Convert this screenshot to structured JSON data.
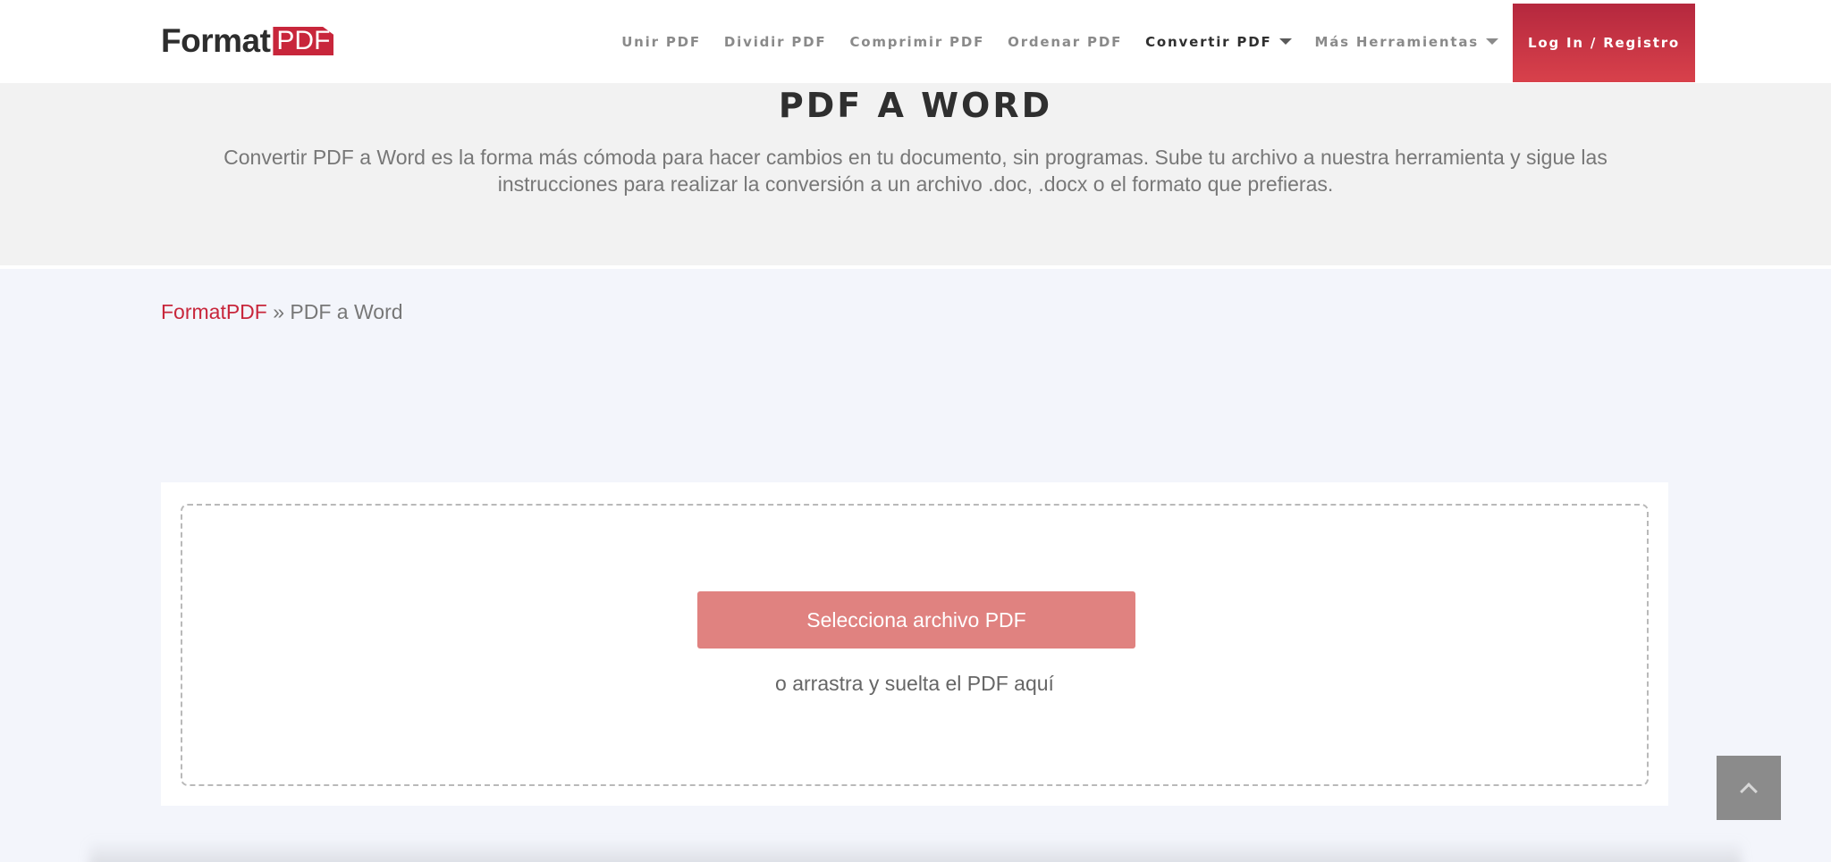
{
  "logo": {
    "format": "Format",
    "pdf": "PDF"
  },
  "nav": {
    "items": [
      {
        "label": "Unir PDF"
      },
      {
        "label": "Dividir PDF"
      },
      {
        "label": "Comprimir PDF"
      },
      {
        "label": "Ordenar PDF"
      },
      {
        "label": "Convertir PDF"
      },
      {
        "label": "Más Herramientas"
      }
    ],
    "login_label": "Log In / Registro"
  },
  "hero": {
    "title": "PDF A WORD",
    "description": "Convertir PDF a Word es la forma más cómoda para hacer cambios en tu documento, sin programas. Sube tu archivo a nuestra herramienta y sigue las instrucciones para realizar la conversión a un archivo .doc, .docx o el formato que prefieras."
  },
  "breadcrumb": {
    "home": "FormatPDF",
    "separator": "»",
    "current": "PDF a Word"
  },
  "upload": {
    "button_label": "Selecciona archivo PDF",
    "drop_text": "o arrastra y suelta el PDF aquí"
  },
  "colors": {
    "brand": "#c8263b",
    "button": "#e08280",
    "login": "#d8414b"
  },
  "icons": {
    "back_to_top": "chevron-up-icon",
    "dropdown": "caret-down-icon"
  }
}
